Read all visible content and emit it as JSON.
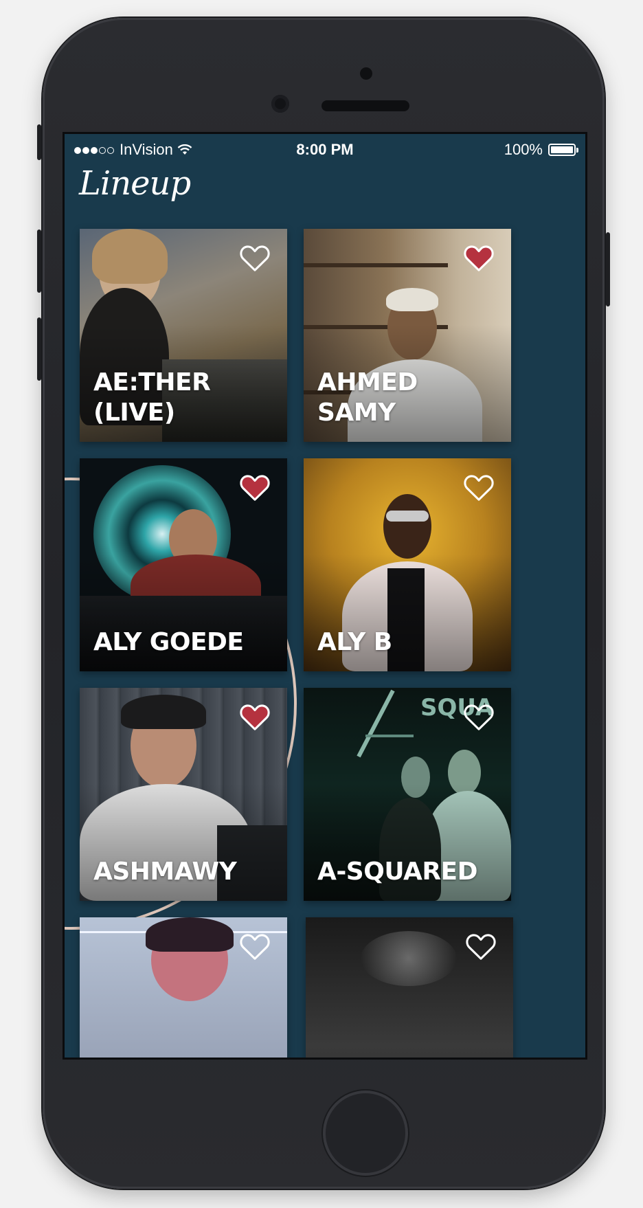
{
  "status_bar": {
    "carrier": "InVision",
    "time": "8:00 PM",
    "battery": "100%",
    "signal_icon": "signal-dots-icon",
    "wifi_icon": "wifi-icon",
    "battery_icon": "battery-icon"
  },
  "page": {
    "title": "Lineup"
  },
  "colors": {
    "background": "#193a4c",
    "favorite": "#b5323f",
    "heart_outline": "#ffffff"
  },
  "artists": [
    {
      "name": "AE:THER (LIVE)",
      "favorited": false
    },
    {
      "name": "AHMED SAMY",
      "favorited": true
    },
    {
      "name": "ALY GOEDE",
      "favorited": true
    },
    {
      "name": "ALY B",
      "favorited": false
    },
    {
      "name": "ASHMAWY",
      "favorited": true
    },
    {
      "name": "A-SQUARED",
      "favorited": false
    },
    {
      "name": "",
      "favorited": false
    },
    {
      "name": "",
      "favorited": false
    }
  ]
}
